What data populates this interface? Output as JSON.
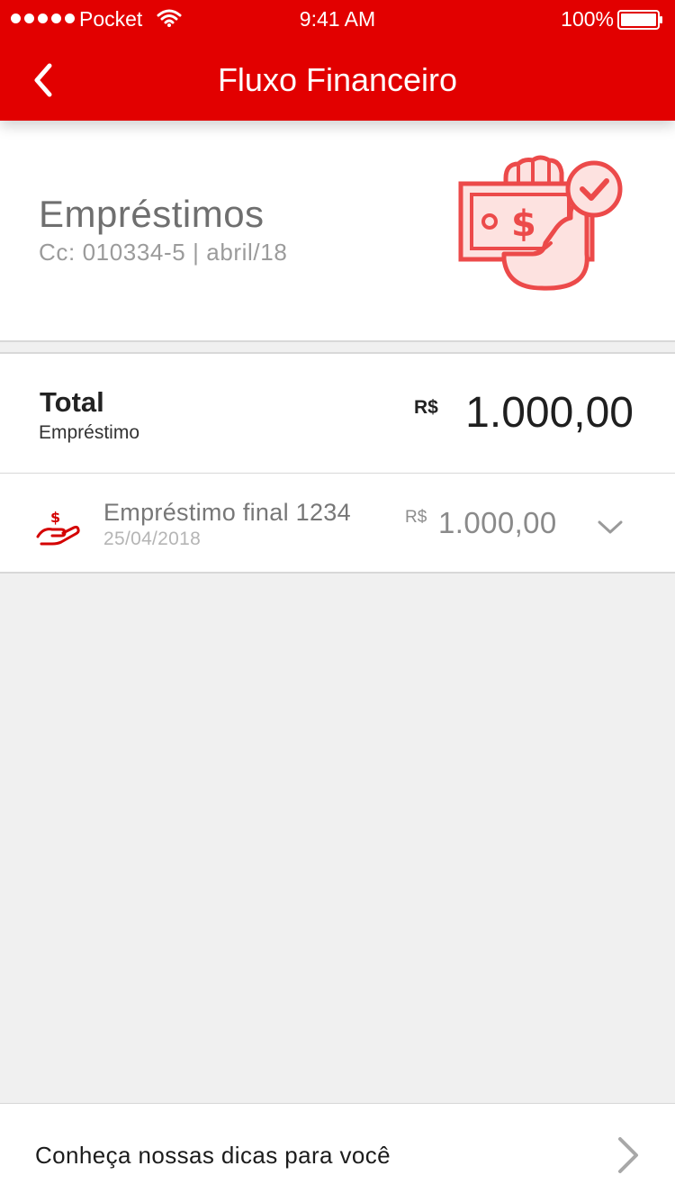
{
  "status_bar": {
    "carrier": "Pocket",
    "time": "9:41 AM",
    "battery": "100%"
  },
  "header": {
    "title": "Fluxo Financeiro"
  },
  "account": {
    "title": "Empréstimos",
    "subtitle": "Cc: 010334-5 | abril/18"
  },
  "total": {
    "label": "Total",
    "sublabel": "Empréstimo",
    "currency": "R$",
    "amount": "1.000,00"
  },
  "loans": [
    {
      "name": "Empréstimo final 1234",
      "date": "25/04/2018",
      "currency": "R$",
      "amount": "1.000,00"
    }
  ],
  "tips": {
    "label": "Conheça nossas dicas para você"
  },
  "colors": {
    "brand_red": "#e20000",
    "illustration_red": "#ec4a4a",
    "illustration_fill": "#fde2e0",
    "background": "#f0f0f0"
  },
  "icons": {
    "back": "chevron-left-icon",
    "hero": "money-hand-check-icon",
    "loan": "hand-dollar-icon",
    "expand": "chevron-down-icon",
    "navigate": "chevron-right-icon"
  }
}
